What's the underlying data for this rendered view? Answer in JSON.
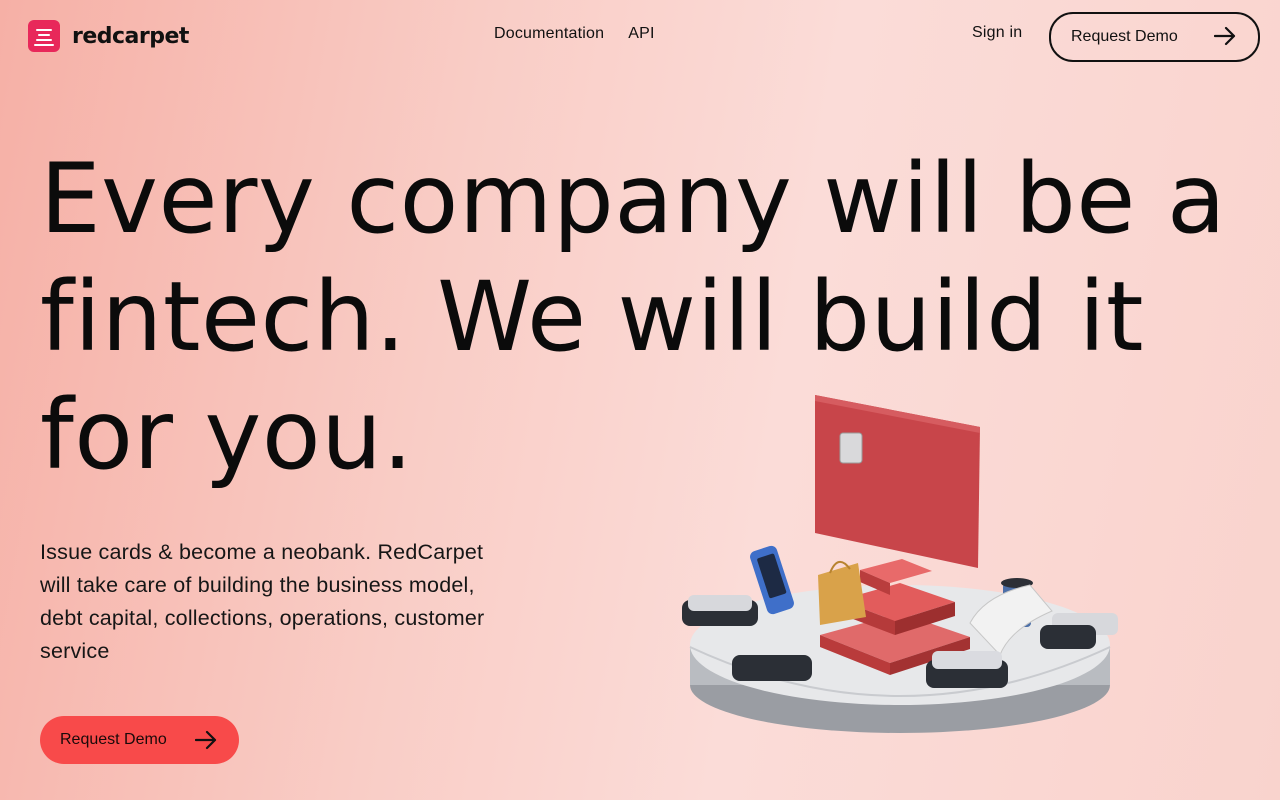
{
  "brand": {
    "name": "redcarpet",
    "accent": "#e8285a"
  },
  "nav": {
    "items": [
      "Documentation",
      "API"
    ]
  },
  "header": {
    "signin_label": "Sign in",
    "demo_label": "Request Demo"
  },
  "hero": {
    "title": "Every company will be a fintech. We will build it for you.",
    "subtitle": "Issue cards & become a neobank. RedCarpet will take care of building the business model, debt capital, collections, operations, customer service",
    "cta_label": "Request Demo",
    "cta_color": "#f84a4a"
  },
  "icons": {
    "arrow": "arrow-right-icon"
  }
}
